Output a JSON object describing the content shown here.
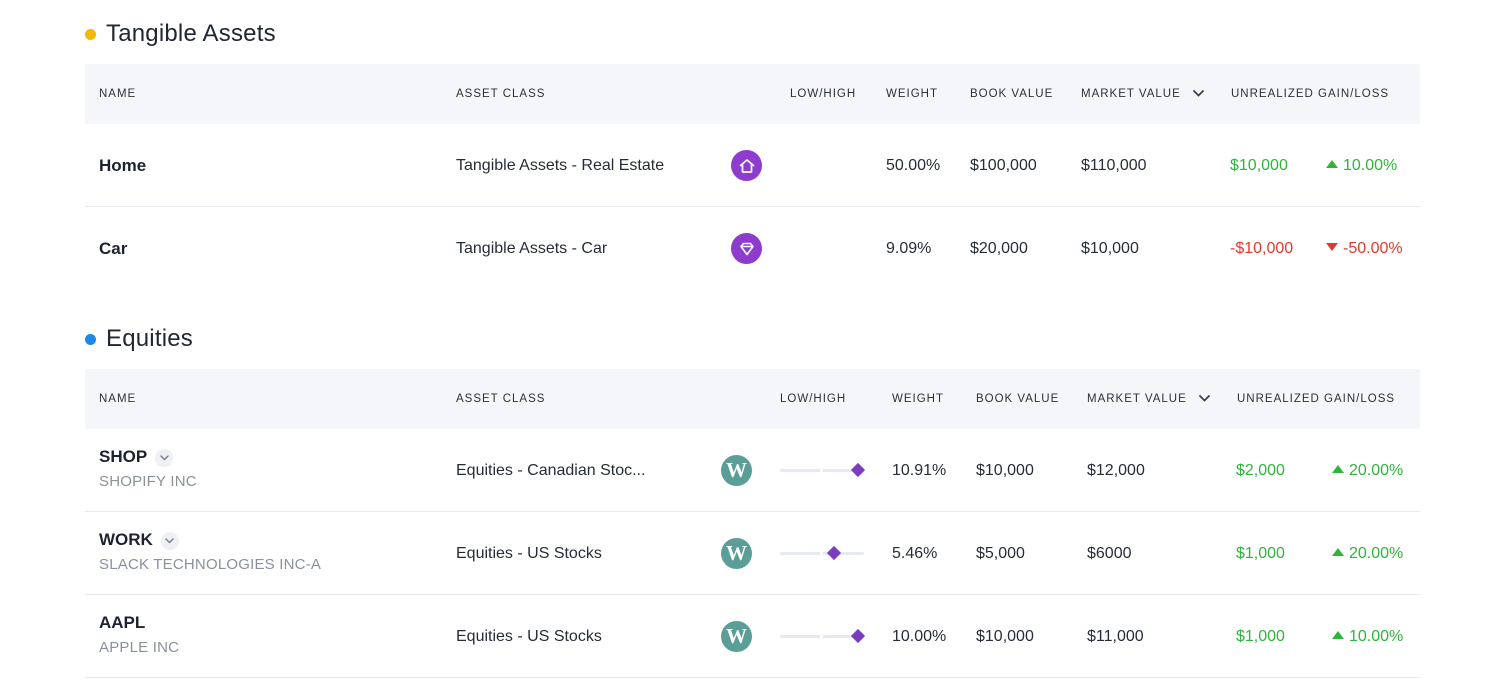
{
  "colors": {
    "tangible_dot": "#f5b800",
    "equities_dot": "#1e88e5",
    "positive": "#2fb43c",
    "negative": "#e2382f"
  },
  "tangible": {
    "title": "Tangible Assets",
    "headers": {
      "name": "NAME",
      "asset_class": "ASSET CLASS",
      "low_high": "LOW/HIGH",
      "weight": "WEIGHT",
      "book_value": "BOOK VALUE",
      "market_value": "MARKET VALUE",
      "unrealized": "UNREALIZED GAIN/LOSS"
    },
    "rows": [
      {
        "name": "Home",
        "asset_class": "Tangible Assets - Real Estate",
        "icon": "home-icon",
        "weight": "50.00%",
        "book_value": "$100,000",
        "market_value": "$110,000",
        "gain": "$10,000",
        "gain_pct": "10.00%",
        "direction": "up"
      },
      {
        "name": "Car",
        "asset_class": "Tangible Assets - Car",
        "icon": "diamond-icon",
        "weight": "9.09%",
        "book_value": "$20,000",
        "market_value": "$10,000",
        "gain": "-$10,000",
        "gain_pct": "-50.00%",
        "direction": "down"
      }
    ]
  },
  "equities": {
    "title": "Equities",
    "headers": {
      "name": "NAME",
      "asset_class": "ASSET CLASS",
      "low_high": "LOW/HIGH",
      "weight": "WEIGHT",
      "book_value": "BOOK VALUE",
      "market_value": "MARKET VALUE",
      "unrealized": "UNREALIZED GAIN/LOSS"
    },
    "rows": [
      {
        "ticker": "SHOP",
        "company": "SHOPIFY INC",
        "asset_class": "Equities - Canadian Stoc...",
        "icon": "wealthsimple-w-icon",
        "range_position": 1.0,
        "weight": "10.91%",
        "book_value": "$10,000",
        "market_value": "$12,000",
        "gain": "$2,000",
        "gain_pct": "20.00%",
        "direction": "up"
      },
      {
        "ticker": "WORK",
        "company": "SLACK TECHNOLOGIES INC-A",
        "asset_class": "Equities - US Stocks",
        "icon": "wealthsimple-w-icon",
        "range_position": 0.68,
        "weight": "5.46%",
        "book_value": "$5,000",
        "market_value": "$6000",
        "gain": "$1,000",
        "gain_pct": "20.00%",
        "direction": "up"
      },
      {
        "ticker": "AAPL",
        "company": "APPLE INC",
        "asset_class": "Equities - US Stocks",
        "icon": "wealthsimple-w-icon",
        "range_position": 1.0,
        "weight": "10.00%",
        "book_value": "$10,000",
        "market_value": "$11,000",
        "gain": "$1,000",
        "gain_pct": "10.00%",
        "direction": "up"
      }
    ]
  }
}
